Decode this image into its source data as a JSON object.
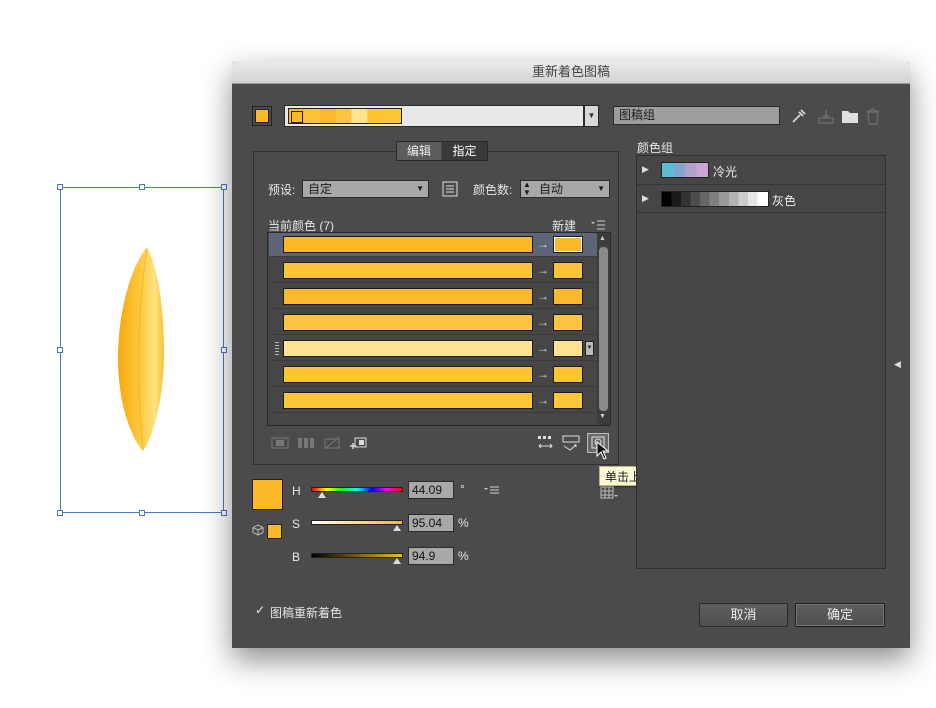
{
  "dialog": {
    "title": "重新着色图稿",
    "group_name": "图稿组",
    "tabs": [
      {
        "label": "编辑"
      },
      {
        "label": "指定"
      }
    ],
    "preset_label": "预设:",
    "preset_value": "自定",
    "colors_count_label": "颜色数:",
    "colors_count_value": "自动",
    "current_colors_label": "当前颜色 (7)",
    "new_label": "新建",
    "color_groups_label": "颜色组",
    "groups": [
      {
        "name": "冷光",
        "swatches": [
          "#5bbdd6",
          "#7fa6cf",
          "#b3a0cf",
          "#c9a6d6"
        ]
      },
      {
        "name": "灰色",
        "swatches": [
          "#000000",
          "#1a1a1a",
          "#333333",
          "#4d4d4d",
          "#666666",
          "#808080",
          "#999999",
          "#b3b3b3",
          "#cccccc",
          "#e6e6e6",
          "#ffffff"
        ]
      }
    ],
    "rows": [
      {
        "current": "#fbb829",
        "new": "#fbb829"
      },
      {
        "current": "#fcc23a",
        "new": "#fcc23a"
      },
      {
        "current": "#fbba2b",
        "new": "#fbba2b"
      },
      {
        "current": "#fdc53f",
        "new": "#fdc53f"
      },
      {
        "current": "#fde38f",
        "new": "#fde38f"
      },
      {
        "current": "#fdc530",
        "new": "#fdc530"
      },
      {
        "current": "#fdc738",
        "new": "#fdc738"
      }
    ],
    "hsb": {
      "h_label": "H",
      "h_value": "44.09",
      "h_unit": "°",
      "s_label": "S",
      "s_value": "95.04",
      "s_unit": "%",
      "b_label": "B",
      "b_value": "94.9",
      "b_unit": "%"
    },
    "tooltip": "单击上面的颜色以在图稿中查找它们",
    "recolor_checkbox_label": "图稿重新着色",
    "recolor_checked": true,
    "cancel_label": "取消",
    "ok_label": "确定",
    "active_color": "#fbb829",
    "checkmark": "✓"
  }
}
